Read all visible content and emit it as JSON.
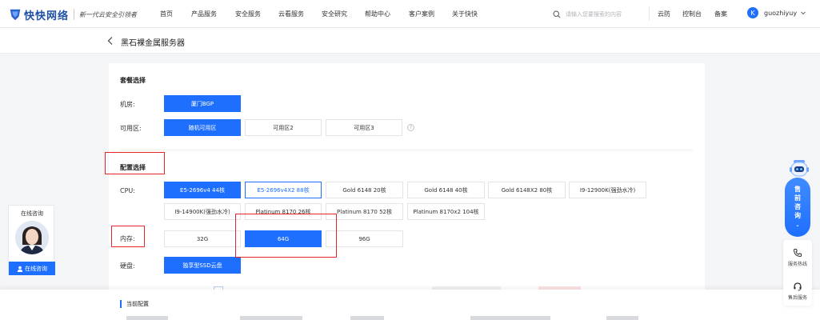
{
  "brand": {
    "name": "快快网络",
    "slogan": "新一代云安全引领者"
  },
  "nav": [
    "首页",
    "产品服务",
    "安全服务",
    "云看服务",
    "安全研究",
    "帮助中心",
    "客户案例",
    "关于快快"
  ],
  "search": {
    "placeholder": "请输入您要搜索的内容"
  },
  "top_links": [
    "云防",
    "控制台",
    "备案"
  ],
  "user": {
    "initial": "K",
    "name": "guozhiyuy"
  },
  "page": {
    "title": "黑石裸金属服务器"
  },
  "package": {
    "title": "套餐选择",
    "room_label": "机房:",
    "rooms": [
      "厦门BGP"
    ],
    "zone_label": "可用区:",
    "zones": [
      "随机可用区",
      "可用区2",
      "可用区3"
    ],
    "zone_help": "?"
  },
  "config": {
    "title": "配置选择",
    "cpu_label": "CPU:",
    "cpus": [
      "E5-2696v4 44核",
      "E5-2696v4X2 88核",
      "Gold 6148 20核",
      "Gold 6148 40核",
      "Gold 6148X2 80核",
      "I9-12900K(强劲水冷)",
      "I9-14900K(强劲水冷)",
      "Platinum 8170 26核",
      "Platinum 8170 52核",
      "Platinum 8170x2 104核"
    ],
    "memory_label": "内存:",
    "memories": [
      "32G",
      "64G",
      "96G"
    ],
    "disk_label": "硬盘:",
    "disks": [
      "独享型SSD云盘"
    ]
  },
  "current": {
    "title": "当前配置"
  },
  "consult": {
    "title": "在线咨询",
    "button": "在线咨询"
  },
  "sidebar": {
    "presale": [
      "售",
      "前",
      "咨",
      "询"
    ],
    "presale_chevron": "⌄",
    "hotline": "服务热线",
    "feedback": "售后服务"
  },
  "colors": {
    "accent": "#1f6fff",
    "highlight": "#e3242b"
  }
}
